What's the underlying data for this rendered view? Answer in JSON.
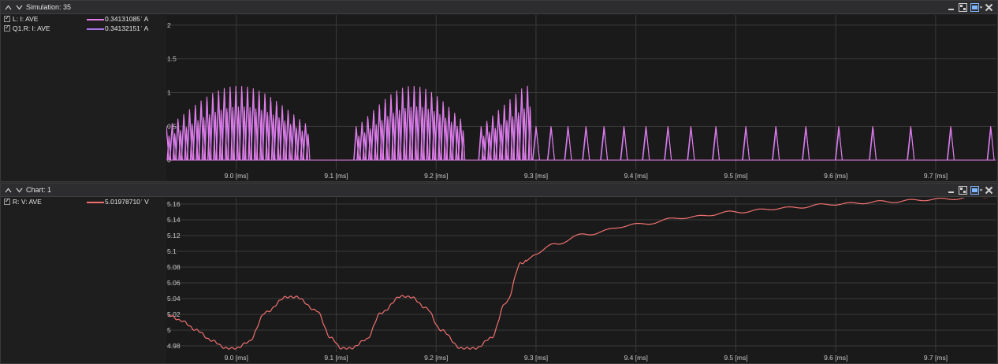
{
  "panels": [
    {
      "title": "Simulation: 35",
      "legend": [
        {
          "name": "L: I: AVE",
          "value": "0.34131085ˈ A",
          "color": "#e57ce8"
        },
        {
          "name": "Q1.R: I: AVE",
          "value": "0.34132151ˈ A",
          "color": "#a873e8"
        }
      ]
    },
    {
      "title": "Chart: 1",
      "legend": [
        {
          "name": "R: V: AVE",
          "value": "5.01978710ˈ V",
          "color": "#f07070"
        }
      ]
    }
  ],
  "icons": [
    "collapse-up-icon",
    "collapse-down-icon",
    "minimize-icon",
    "maximize-icon",
    "tile-icon",
    "close-icon"
  ],
  "chart_data": [
    {
      "type": "line",
      "x_tick_labels": [
        "9.0 [ms]",
        "9.1 [ms]",
        "9.2 [ms]",
        "9.3 [ms]",
        "9.4 [ms]",
        "9.5 [ms]",
        "9.6 [ms]",
        "9.7 [ms]"
      ],
      "x_ticks_ms": [
        9.0,
        9.1,
        9.2,
        9.3,
        9.4,
        9.5,
        9.6,
        9.7
      ],
      "xlim_ms": [
        8.93,
        9.76
      ],
      "y_tick_labels": [
        "0",
        "0.5",
        "1",
        "1.5",
        "2"
      ],
      "ylim": [
        -0.15,
        2.15
      ],
      "grid": true,
      "series": [
        {
          "name": "L: I: AVE",
          "color": "#e57ce8",
          "description": "pulsed triangular inductor current",
          "bursts_ms": [
            [
              8.93,
              9.07
            ],
            [
              9.12,
              9.23
            ],
            [
              9.245,
              9.295
            ]
          ],
          "burst_peak": 1.1,
          "base_peak": 0.5,
          "peaks_ms": [
            9.3,
            9.315,
            9.332,
            9.35,
            9.368,
            9.388,
            9.41,
            9.432,
            9.455,
            9.48,
            9.51,
            9.54,
            9.57,
            9.603,
            9.637,
            9.675,
            9.715,
            9.755
          ]
        },
        {
          "name": "Q1.R: I: AVE",
          "color": "#a873e8"
        }
      ]
    },
    {
      "type": "line",
      "x_tick_labels": [
        "9.0 [ms]",
        "9.1 [ms]",
        "9.2 [ms]",
        "9.3 [ms]",
        "9.4 [ms]",
        "9.5 [ms]",
        "9.6 [ms]",
        "9.7 [ms]"
      ],
      "x_ticks_ms": [
        9.0,
        9.1,
        9.2,
        9.3,
        9.4,
        9.5,
        9.6,
        9.7
      ],
      "xlim_ms": [
        8.93,
        9.76
      ],
      "y_tick_labels": [
        "4.98",
        "5",
        "5.02",
        "5.04",
        "5.06",
        "5.08",
        "5.1",
        "5.12",
        "5.14",
        "5.16"
      ],
      "ylim": [
        4.972,
        5.168
      ],
      "grid": true,
      "series": [
        {
          "name": "R: V: AVE",
          "color": "#f07070",
          "points": [
            [
              8.932,
              5.019
            ],
            [
              8.945,
              5.012
            ],
            [
              8.96,
              5.0
            ],
            [
              8.975,
              4.987
            ],
            [
              8.99,
              4.977
            ],
            [
              9.0,
              4.977
            ],
            [
              9.012,
              4.985
            ],
            [
              9.03,
              5.023
            ],
            [
              9.05,
              5.042
            ],
            [
              9.06,
              5.042
            ],
            [
              9.08,
              5.025
            ],
            [
              9.095,
              4.99
            ],
            [
              9.105,
              4.977
            ],
            [
              9.115,
              4.977
            ],
            [
              9.13,
              4.988
            ],
            [
              9.145,
              5.022
            ],
            [
              9.165,
              5.043
            ],
            [
              9.175,
              5.042
            ],
            [
              9.19,
              5.028
            ],
            [
              9.205,
              5.0
            ],
            [
              9.225,
              4.977
            ],
            [
              9.24,
              4.977
            ],
            [
              9.255,
              4.99
            ],
            [
              9.27,
              5.035
            ],
            [
              9.285,
              5.085
            ],
            [
              9.3,
              5.097
            ],
            [
              9.32,
              5.11
            ],
            [
              9.35,
              5.122
            ],
            [
              9.4,
              5.134
            ],
            [
              9.45,
              5.143
            ],
            [
              9.5,
              5.15
            ],
            [
              9.55,
              5.155
            ],
            [
              9.6,
              5.16
            ],
            [
              9.65,
              5.163
            ],
            [
              9.7,
              5.166
            ],
            [
              9.758,
              5.17
            ]
          ]
        }
      ]
    }
  ]
}
